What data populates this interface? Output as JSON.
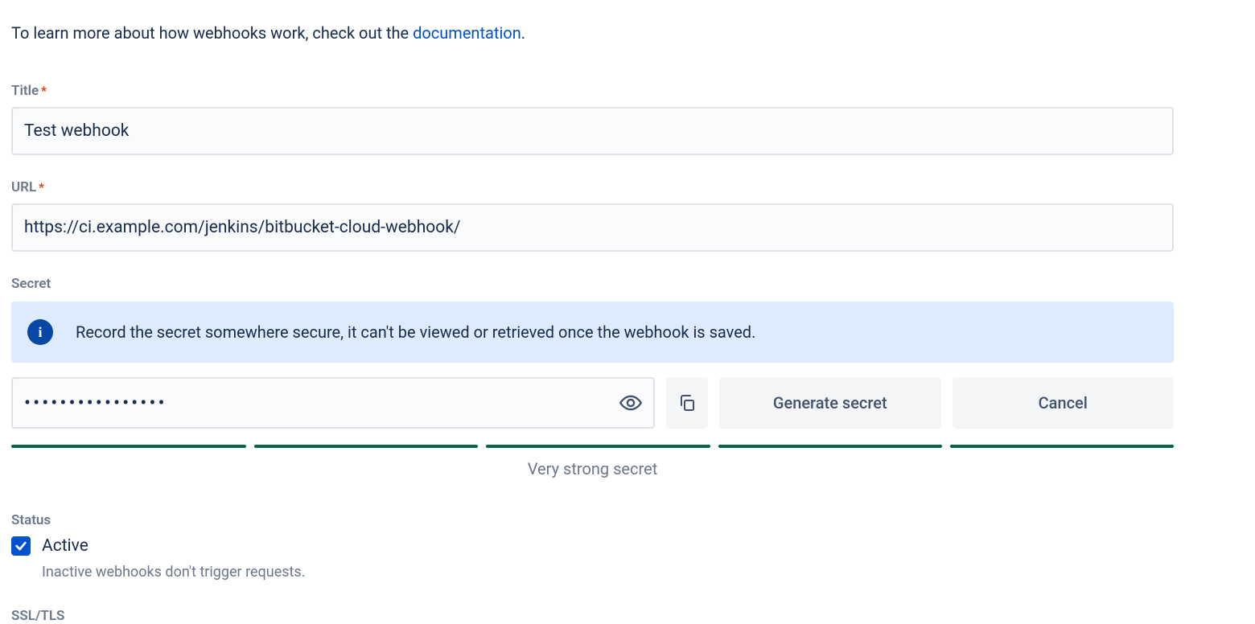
{
  "intro": {
    "prefix": "To learn more about how webhooks work, check out the ",
    "link_text": "documentation",
    "suffix": "."
  },
  "fields": {
    "title": {
      "label": "Title",
      "required_marker": "*",
      "value": "Test webhook"
    },
    "url": {
      "label": "URL",
      "required_marker": "*",
      "value": "https://ci.example.com/jenkins/bitbucket-cloud-webhook/"
    },
    "secret": {
      "label": "Secret",
      "info_text": "Record the secret somewhere secure, it can't be viewed or retrieved once the webhook is saved.",
      "value_masked": "••••••••••••••••",
      "generate_label": "Generate secret",
      "cancel_label": "Cancel",
      "strength_text": "Very strong secret",
      "strength_segments": 5,
      "strength_color": "#006644"
    },
    "status": {
      "label": "Status",
      "checkbox_label": "Active",
      "checked": true,
      "hint": "Inactive webhooks don't trigger requests."
    },
    "ssl": {
      "label": "SSL/TLS"
    }
  },
  "icons": {
    "info": "info-icon",
    "eye": "eye-icon",
    "copy": "copy-icon",
    "check": "check-icon"
  }
}
